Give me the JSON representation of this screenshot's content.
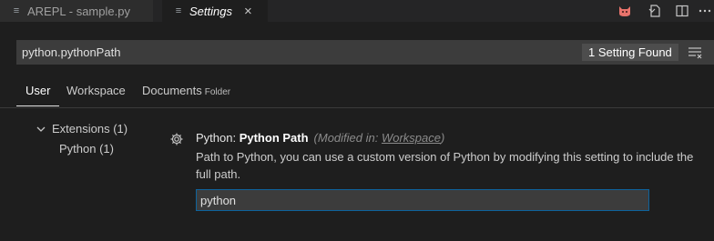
{
  "tabs": [
    {
      "label": "AREPL - sample.py",
      "icon": "lines-file-icon",
      "active": false
    },
    {
      "label": "Settings",
      "icon": "lines-file-icon",
      "active": true
    }
  ],
  "actions": [
    "cat-icon",
    "open-json-icon",
    "split-editor-icon",
    "more-actions-icon"
  ],
  "search": {
    "value": "python.pythonPath",
    "result_badge": "1 Setting Found"
  },
  "scopes": [
    {
      "label": "User",
      "active": true
    },
    {
      "label": "Workspace",
      "active": false
    },
    {
      "label": "Documents",
      "suffix": "Folder",
      "active": false
    }
  ],
  "toc": {
    "extensions": "Extensions (1)",
    "python": "Python (1)"
  },
  "setting": {
    "category": "Python: ",
    "name": "Python Path",
    "modified_prefix": "(Modified in: ",
    "modified_link": "Workspace",
    "modified_suffix": ")",
    "description": "Path to Python, you can use a custom version of Python by modifying this setting to include the full path.",
    "value": "python"
  },
  "colors": {
    "accent": "#0e639c",
    "background": "#1e1e1e",
    "cat_icon": "#e8736b"
  }
}
